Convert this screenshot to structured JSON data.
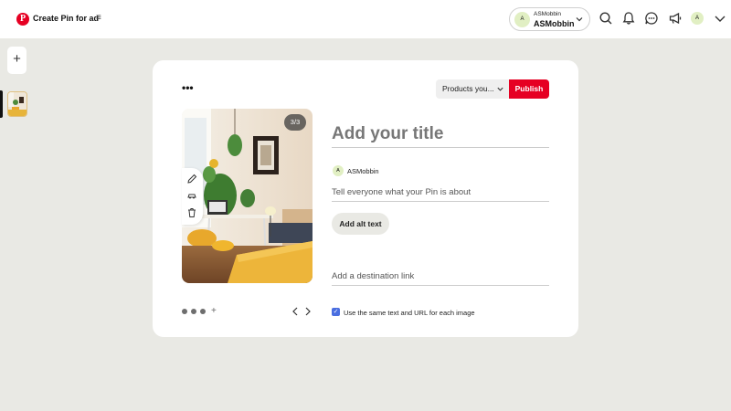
{
  "header": {
    "app_title": "Create Pin for ad",
    "menu_glyph": "≡",
    "account": {
      "small_label": "ASMobbin",
      "name": "ASMobbin",
      "avatar_letter": "A"
    },
    "user_avatar_letter": "A",
    "icons": [
      "search-icon",
      "notifications-icon",
      "messages-icon",
      "ads-megaphone-icon"
    ]
  },
  "rail": {
    "add_glyph": "+"
  },
  "card": {
    "more_glyph": "•••",
    "products_select": "Products you...",
    "publish_label": "Publish",
    "image_counter": "3/3",
    "title_placeholder": "Add your title",
    "author_avatar_letter": "A",
    "author_name": "ASMobbin",
    "description_placeholder": "Tell everyone what your Pin is about",
    "alt_text_button": "Add alt text",
    "link_placeholder": "Add a destination link",
    "same_text_checkbox_label": "Use the same text and URL for each image",
    "same_text_checked": true,
    "add_image_glyph": "+",
    "image_tools": [
      "edit-pencil-icon",
      "product-tag-icon",
      "delete-trash-icon"
    ]
  },
  "colors": {
    "brand_red": "#e60023",
    "checkbox_blue": "#4a6ee0",
    "background": "#e9e9e4"
  }
}
